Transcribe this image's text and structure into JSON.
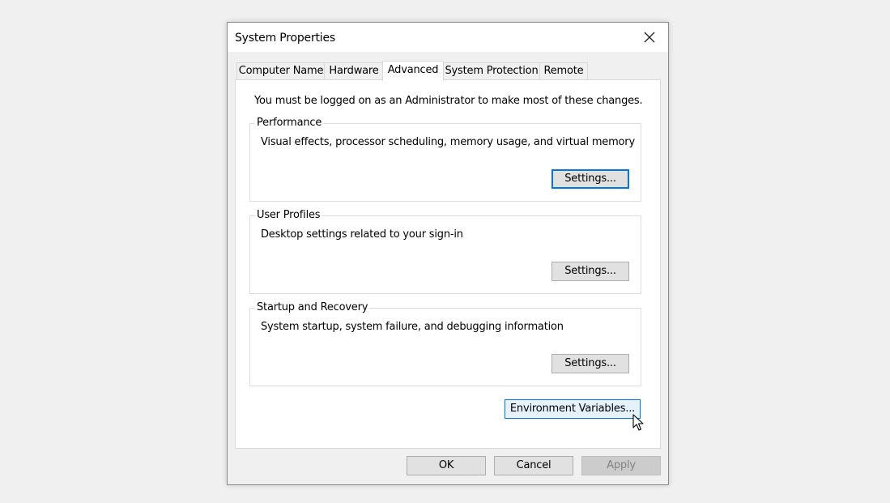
{
  "window": {
    "title": "System Properties"
  },
  "tabs": [
    {
      "label": "Computer Name",
      "active": false
    },
    {
      "label": "Hardware",
      "active": false
    },
    {
      "label": "Advanced",
      "active": true
    },
    {
      "label": "System Protection",
      "active": false
    },
    {
      "label": "Remote",
      "active": false
    }
  ],
  "panel": {
    "note": "You must be logged on as an Administrator to make most of these changes.",
    "groups": [
      {
        "legend": "Performance",
        "description": "Visual effects, processor scheduling, memory usage, and virtual memory",
        "button": "Settings..."
      },
      {
        "legend": "User Profiles",
        "description": "Desktop settings related to your sign-in",
        "button": "Settings..."
      },
      {
        "legend": "Startup and Recovery",
        "description": "System startup, system failure, and debugging information",
        "button": "Settings..."
      }
    ],
    "env_button": "Environment Variables..."
  },
  "footer": {
    "ok": "OK",
    "cancel": "Cancel",
    "apply": "Apply"
  },
  "colors": {
    "focus_blue": "#0078d7",
    "hover_bg": "#e5f1fb"
  },
  "icons": {
    "close": "close-icon",
    "cursor": "mouse-pointer-icon"
  }
}
